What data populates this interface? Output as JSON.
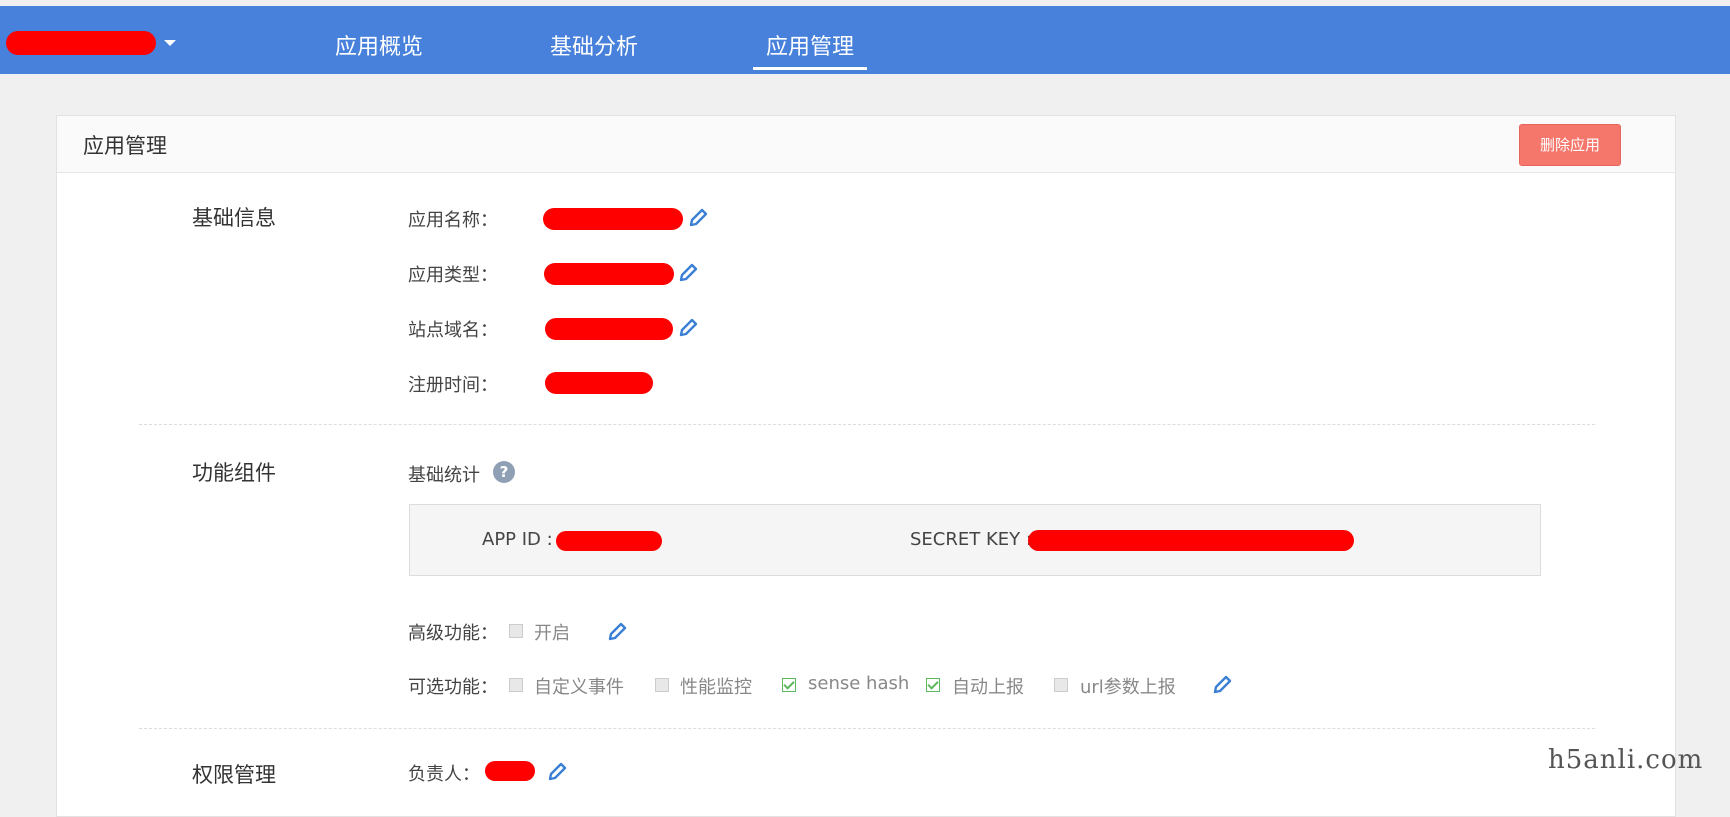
{
  "nav": {
    "tabs": [
      {
        "label": "应用概览"
      },
      {
        "label": "基础分析"
      },
      {
        "label": "应用管理",
        "active": true
      }
    ]
  },
  "card": {
    "title": "应用管理",
    "delete_label": "删除应用"
  },
  "basic_info": {
    "section_title": "基础信息",
    "fields": [
      {
        "label": "应用名称："
      },
      {
        "label": "应用类型："
      },
      {
        "label": "站点域名："
      },
      {
        "label": "注册时间："
      }
    ]
  },
  "components": {
    "section_title": "功能组件",
    "basic_stats_label": "基础统计",
    "help_glyph": "?",
    "app_id_label": "APP ID :",
    "secret_key_label": "SECRET KEY :",
    "advanced_label": "高级功能：",
    "advanced_option": {
      "label": "开启",
      "checked": false
    },
    "optional_label": "可选功能：",
    "optional_options": [
      {
        "label": "自定义事件",
        "checked": false
      },
      {
        "label": "性能监控",
        "checked": false
      },
      {
        "label": "sense hash",
        "checked": true
      },
      {
        "label": "自动上报",
        "checked": true
      },
      {
        "label": "url参数上报",
        "checked": false
      }
    ]
  },
  "permissions": {
    "section_title": "权限管理",
    "owner_label": "负责人："
  },
  "watermark": "h5anli.com",
  "colors": {
    "topbar": "#4781dc",
    "delete_button": "#f5776c",
    "pencil": "#3a7fd5",
    "check": "#5cb85c"
  }
}
